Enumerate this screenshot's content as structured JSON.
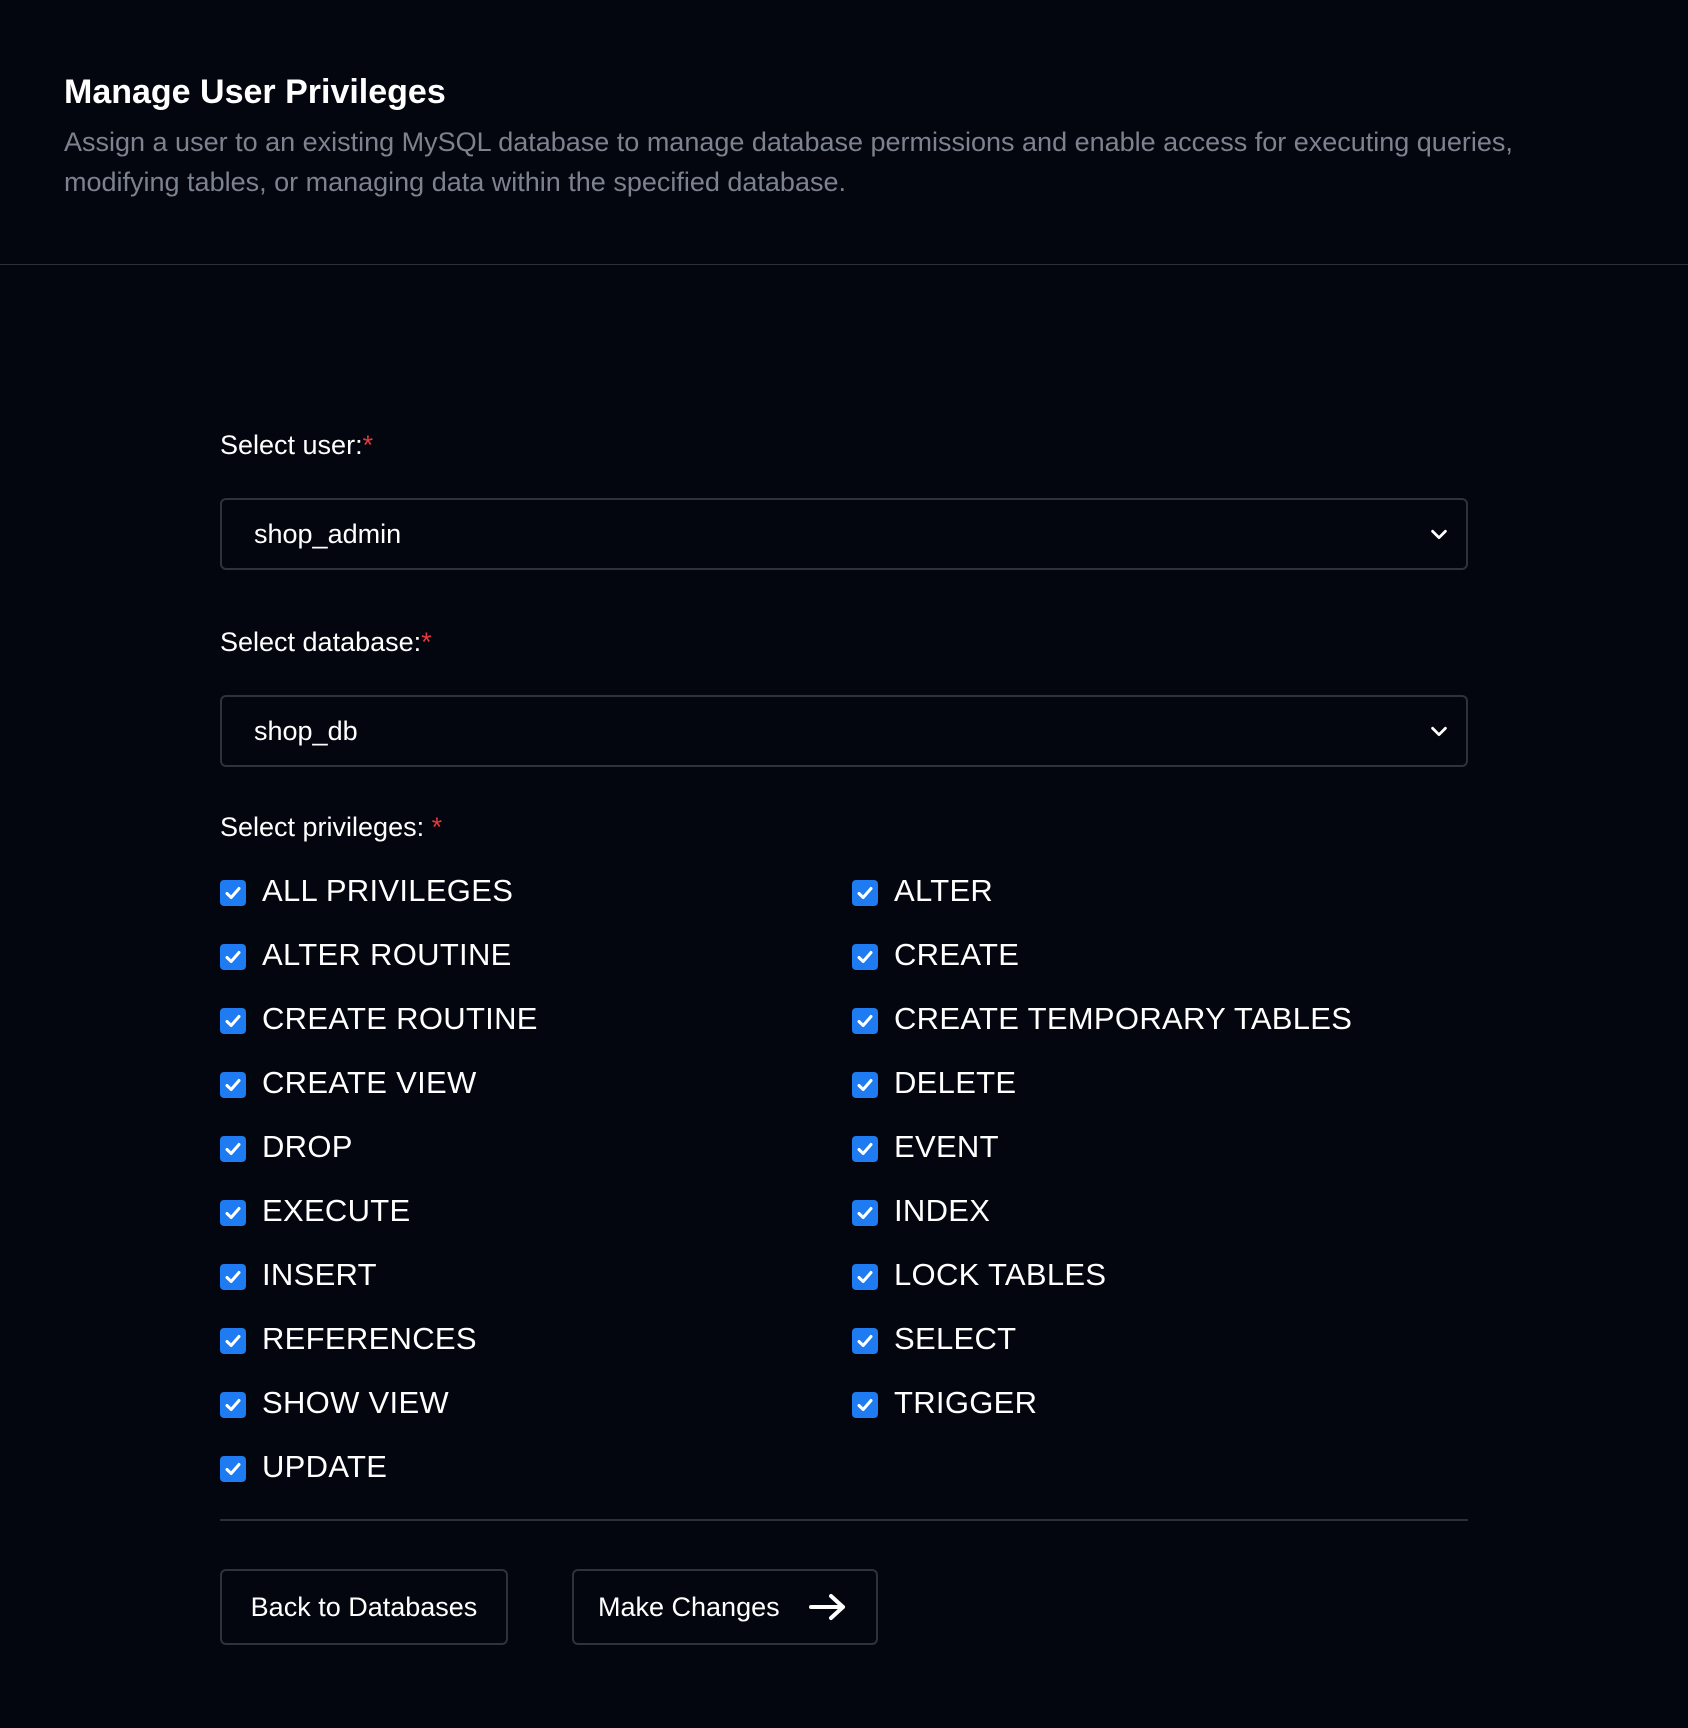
{
  "header": {
    "title": "Manage User Privileges",
    "description": "Assign a user to an existing MySQL database to manage database permissions and enable access for executing queries, modifying tables, or managing data within the specified database."
  },
  "form": {
    "user_label": "Select user:",
    "user_required": "*",
    "user_value": "shop_admin",
    "database_label": "Select database:",
    "database_required": "*",
    "database_value": "shop_db",
    "privileges_label": "Select privileges: ",
    "privileges_required": "*",
    "privileges": [
      {
        "label": "ALL PRIVILEGES",
        "checked": true
      },
      {
        "label": "ALTER",
        "checked": true
      },
      {
        "label": "ALTER ROUTINE",
        "checked": true
      },
      {
        "label": "CREATE",
        "checked": true
      },
      {
        "label": "CREATE ROUTINE",
        "checked": true
      },
      {
        "label": "CREATE TEMPORARY TABLES",
        "checked": true
      },
      {
        "label": "CREATE VIEW",
        "checked": true
      },
      {
        "label": "DELETE",
        "checked": true
      },
      {
        "label": "DROP",
        "checked": true
      },
      {
        "label": "EVENT",
        "checked": true
      },
      {
        "label": "EXECUTE",
        "checked": true
      },
      {
        "label": "INDEX",
        "checked": true
      },
      {
        "label": "INSERT",
        "checked": true
      },
      {
        "label": "LOCK TABLES",
        "checked": true
      },
      {
        "label": "REFERENCES",
        "checked": true
      },
      {
        "label": "SELECT",
        "checked": true
      },
      {
        "label": "SHOW VIEW",
        "checked": true
      },
      {
        "label": "TRIGGER",
        "checked": true
      },
      {
        "label": "UPDATE",
        "checked": true
      }
    ]
  },
  "actions": {
    "back_label": "Back to Databases",
    "make_label": "Make Changes"
  },
  "icons": {
    "select_chevron": "chevron-down-icon",
    "checkbox": "check-icon",
    "make_changes": "arrow-right-icon"
  },
  "colors": {
    "background": "#04060f",
    "accent": "#1e7bf2",
    "required": "#e5383b",
    "muted_text": "#7d828f",
    "border": "#2e323c"
  }
}
